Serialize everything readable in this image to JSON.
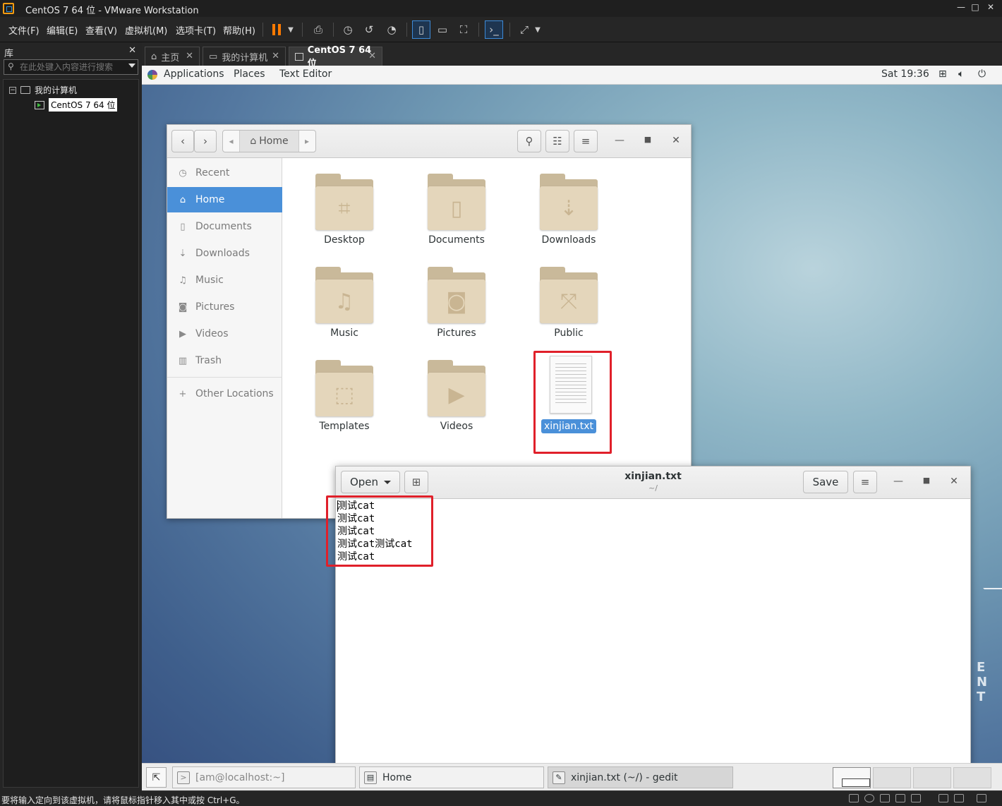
{
  "vmware": {
    "window_title": "CentOS 7 64 位 - VMware Workstation",
    "menu": [
      "文件(F)",
      "编辑(E)",
      "查看(V)",
      "虚拟机(M)",
      "选项卡(T)",
      "帮助(H)"
    ],
    "library": {
      "title": "库",
      "search_placeholder": "在此处键入内容进行搜索",
      "tree": {
        "root": "我的计算机",
        "vm": "CentOS 7 64 位"
      }
    },
    "tabs": [
      {
        "label": "主页"
      },
      {
        "label": "我的计算机"
      },
      {
        "label": "CentOS 7 64 位"
      }
    ],
    "status_text": "要将输入定向到该虚拟机，请将鼠标指针移入其中或按 Ctrl+G。"
  },
  "gnome": {
    "menu": [
      "Applications",
      "Places",
      "Text Editor"
    ],
    "clock": "Sat 19:36",
    "brand_partial": "E N T"
  },
  "nautilus": {
    "path_current": "Home",
    "sidebar": [
      {
        "label": "Recent",
        "icon": "clock-icon"
      },
      {
        "label": "Home",
        "icon": "home-icon"
      },
      {
        "label": "Documents",
        "icon": "document-icon"
      },
      {
        "label": "Downloads",
        "icon": "download-icon"
      },
      {
        "label": "Music",
        "icon": "music-icon"
      },
      {
        "label": "Pictures",
        "icon": "camera-icon"
      },
      {
        "label": "Videos",
        "icon": "video-icon"
      },
      {
        "label": "Trash",
        "icon": "trash-icon"
      },
      {
        "label": "Other Locations",
        "icon": "plus-icon"
      }
    ],
    "items": [
      {
        "label": "Desktop",
        "icon": "desktop-folder-icon"
      },
      {
        "label": "Documents",
        "icon": "documents-folder-icon"
      },
      {
        "label": "Downloads",
        "icon": "downloads-folder-icon"
      },
      {
        "label": "Music",
        "icon": "music-folder-icon"
      },
      {
        "label": "Pictures",
        "icon": "pictures-folder-icon"
      },
      {
        "label": "Public",
        "icon": "public-folder-icon"
      },
      {
        "label": "Templates",
        "icon": "templates-folder-icon"
      },
      {
        "label": "Videos",
        "icon": "videos-folder-icon"
      },
      {
        "label": "xinjian.txt",
        "icon": "text-file-icon"
      }
    ],
    "selected_item": "xinjian.txt"
  },
  "gedit": {
    "open_label": "Open",
    "save_label": "Save",
    "title": "xinjian.txt",
    "subtitle": "~/",
    "lines": [
      "测试cat",
      "测试cat",
      "测试cat",
      "测试cat测试cat",
      "测试cat"
    ]
  },
  "taskbar": {
    "items": [
      {
        "label": "[am@localhost:~]"
      },
      {
        "label": "Home"
      },
      {
        "label": "xinjian.txt (~/) - gedit"
      }
    ]
  },
  "colors": {
    "selection": "#4a90d9",
    "annotation": "#e0202a",
    "vm_accent": "#ff7a00"
  }
}
